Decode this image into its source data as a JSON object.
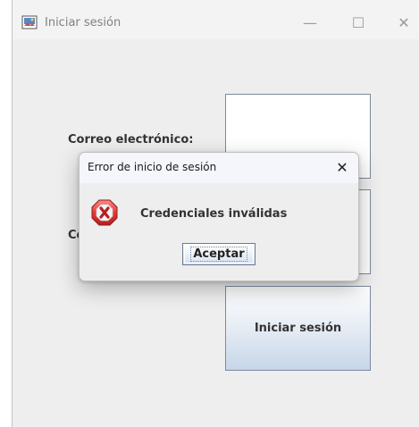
{
  "window": {
    "title": "Iniciar sesión",
    "controls": {
      "minimize": "—",
      "maximize": "☐",
      "close": "✕"
    }
  },
  "form": {
    "email_label": "Correo electrónico:",
    "password_label": "Contraseña:",
    "email_value": "",
    "password_value": "",
    "login_button": "Iniciar sesión"
  },
  "dialog": {
    "title": "Error de inicio de sesión",
    "close": "✕",
    "message": "Credenciales inválidas",
    "ok_button": "Aceptar",
    "icon": "error-icon"
  },
  "colors": {
    "window_bg": "#eeeeee",
    "button_gradient_end": "#c7d6e8",
    "error_red": "#e03a3a"
  }
}
